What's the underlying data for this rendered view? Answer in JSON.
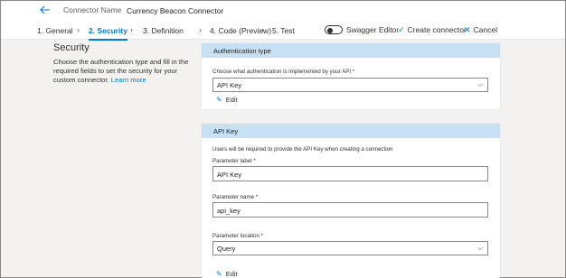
{
  "header": {
    "connector_name_label": "Connector Name",
    "connector_name_value": "Currency Beacon Connector"
  },
  "steps": [
    {
      "label": "1. General"
    },
    {
      "label": "2. Security"
    },
    {
      "label": "3. Definition"
    },
    {
      "label": "4. Code (Preview)"
    },
    {
      "label": "5. Test"
    }
  ],
  "toolbar": {
    "swagger_label": "Swagger Editor",
    "create_label": "Create connector",
    "cancel_label": "Cancel"
  },
  "security": {
    "title": "Security",
    "description": "Choose the authentication type and fill in the required fields to set the security for your custom connector.",
    "learn_more": "Learn more"
  },
  "auth_card": {
    "header": "Authentication type",
    "label": "Choose what authentication is implemented by your API *",
    "selected": "API Key",
    "edit": "Edit"
  },
  "apikey_card": {
    "header": "API Key",
    "note": "Users will be required to provide the API Key when creating a connection",
    "param_label_label": "Parameter label *",
    "param_label_value": "API Key",
    "param_name_label": "Parameter name *",
    "param_name_value": "api_key",
    "param_location_label": "Parameter location *",
    "param_location_value": "Query",
    "edit": "Edit"
  },
  "colors": {
    "accent": "#0078d4",
    "card_header": "#c7e0f4",
    "background": "#f3f2f1"
  },
  "icons": {
    "back": "back-arrow-icon",
    "create": "checkmark-icon",
    "cancel": "close-icon",
    "edit": "pencil-icon",
    "dropdown": "chevron-down-icon"
  }
}
